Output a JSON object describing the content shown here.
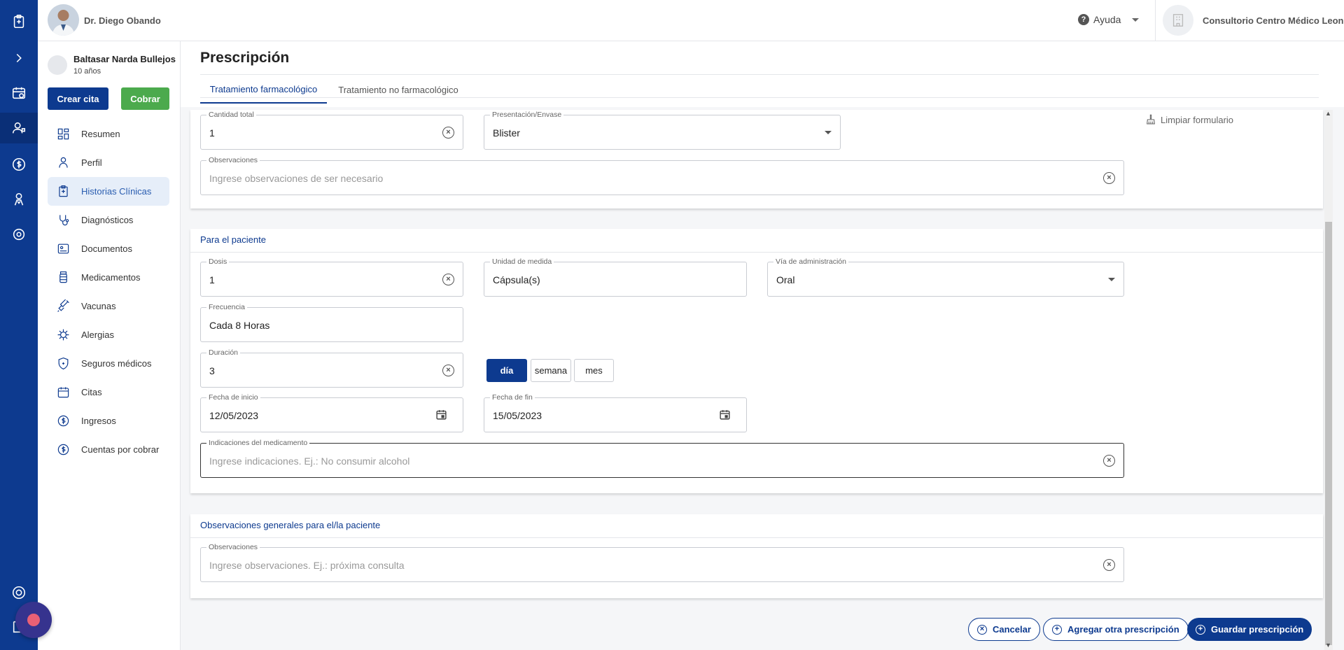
{
  "topbar": {
    "doctor_name": "Dr. Diego Obando",
    "help_label": "Ayuda",
    "clinic_name": "Consultorio Centro Médico Leon"
  },
  "patient": {
    "name": "Baltasar Narda Bullejos",
    "age": "10 años"
  },
  "side_buttons": {
    "create_appointment": "Crear cita",
    "charge": "Cobrar"
  },
  "menu": [
    {
      "label": "Resumen",
      "icon": "dashboard-icon"
    },
    {
      "label": "Perfil",
      "icon": "doctor-icon"
    },
    {
      "label": "Historias Clínicas",
      "icon": "clinical-record-icon",
      "active": true
    },
    {
      "label": "Diagnósticos",
      "icon": "stethoscope-icon"
    },
    {
      "label": "Documentos",
      "icon": "document-icon"
    },
    {
      "label": "Medicamentos",
      "icon": "medicine-bottle-icon"
    },
    {
      "label": "Vacunas",
      "icon": "syringe-icon"
    },
    {
      "label": "Alergias",
      "icon": "allergy-icon"
    },
    {
      "label": "Seguros médicos",
      "icon": "insurance-shield-icon"
    },
    {
      "label": "Citas",
      "icon": "calendar-icon"
    },
    {
      "label": "Ingresos",
      "icon": "dollar-icon"
    },
    {
      "label": "Cuentas por cobrar",
      "icon": "dollar-icon"
    }
  ],
  "page": {
    "title": "Prescripción",
    "tabs": [
      "Tratamiento farmacológico",
      "Tratamiento no farmacológico"
    ],
    "clear_form": "Limpiar formulario"
  },
  "section1": {
    "cantidad_total": {
      "label": "Cantidad total",
      "value": "1"
    },
    "presentacion": {
      "label": "Presentación/Envase",
      "value": "Blister"
    },
    "observaciones": {
      "label": "Observaciones",
      "placeholder": "Ingrese observaciones de ser necesario"
    }
  },
  "section2": {
    "title": "Para el paciente",
    "dosis": {
      "label": "Dosis",
      "value": "1"
    },
    "unidad": {
      "label": "Unidad de medida",
      "value": "Cápsula(s)"
    },
    "via": {
      "label": "Vía de administración",
      "value": "Oral"
    },
    "frecuencia": {
      "label": "Frecuencia",
      "value": "Cada 8 Horas"
    },
    "duracion": {
      "label": "Duración",
      "value": "3"
    },
    "duration_units": [
      "día",
      "semana",
      "mes"
    ],
    "duration_selected": "día",
    "fecha_inicio": {
      "label": "Fecha de inicio",
      "value": "12/05/2023"
    },
    "fecha_fin": {
      "label": "Fecha de fin",
      "value": "15/05/2023"
    },
    "indicaciones": {
      "label": "Indicaciones del medicamento",
      "placeholder": "Ingrese indicaciones. Ej.: No consumir alcohol"
    }
  },
  "section3": {
    "title": "Observaciones generales para el/la paciente",
    "observaciones": {
      "label": "Observaciones",
      "placeholder": "Ingrese observaciones. Ej.: próxima consulta"
    }
  },
  "actions": {
    "cancel": "Cancelar",
    "add_another": "Agregar otra prescripción",
    "save": "Guardar prescripción"
  },
  "colors": {
    "primary": "#0d3a8f",
    "success": "#4caa4d",
    "chat_bubble": "#36338e"
  }
}
